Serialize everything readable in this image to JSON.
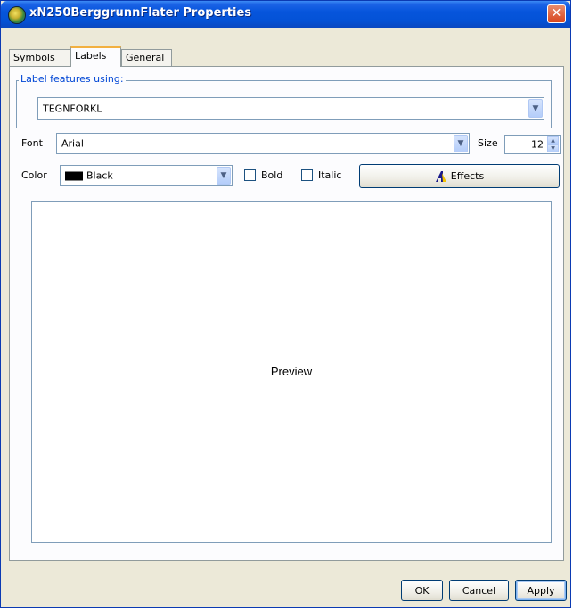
{
  "window": {
    "title": "xN250BerggrunnFlater Properties",
    "close_glyph": "✕"
  },
  "tabs": [
    {
      "label": "Symbols",
      "active": false
    },
    {
      "label": "Labels",
      "active": true
    },
    {
      "label": "General",
      "active": false
    }
  ],
  "label_features": {
    "group_label": "Label features using:",
    "selected": "TEGNFORKL"
  },
  "font": {
    "label": "Font",
    "value": "Arial",
    "size_label": "Size",
    "size_value": "12"
  },
  "color": {
    "label": "Color",
    "value": "Black",
    "swatch": "#000000"
  },
  "style": {
    "bold_label": "Bold",
    "bold_checked": false,
    "italic_label": "Italic",
    "italic_checked": false
  },
  "effects": {
    "label": "Effects",
    "icon": "effects-icon"
  },
  "preview": {
    "text": "Preview"
  },
  "buttons": {
    "ok": "OK",
    "cancel": "Cancel",
    "apply": "Apply"
  },
  "colors": {
    "titlebar": "#0655dc",
    "dialog_bg": "#ece9d8",
    "group_label": "#0046d5",
    "close_button": "#d8461e"
  }
}
